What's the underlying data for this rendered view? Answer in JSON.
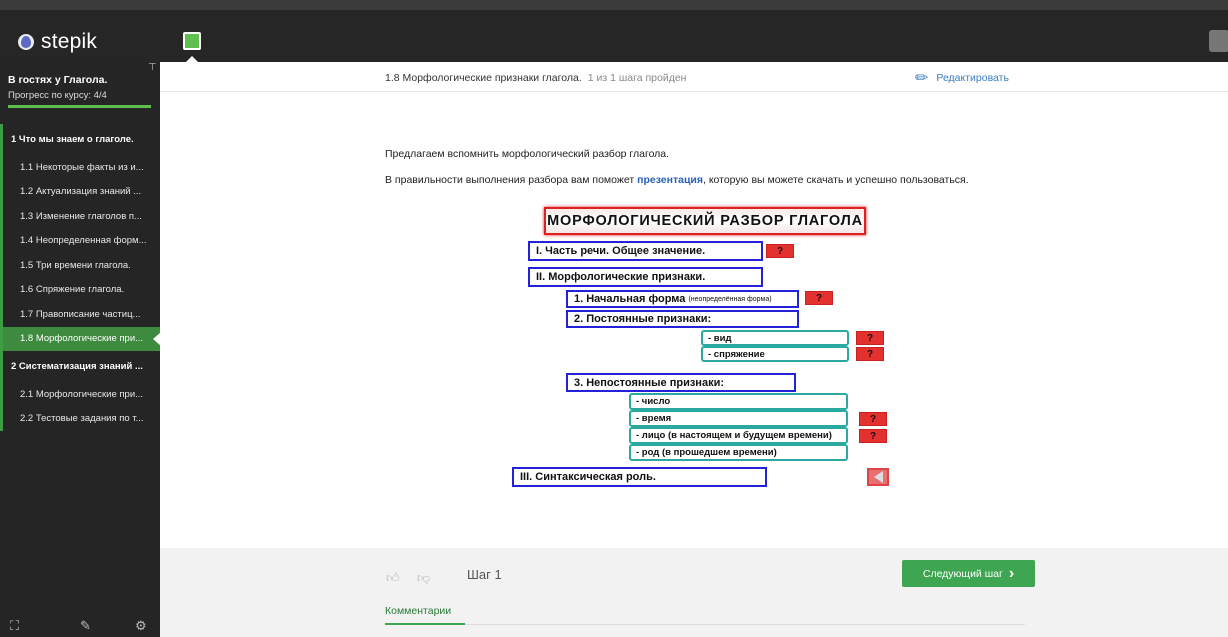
{
  "app": {
    "name": "stepik"
  },
  "sidebar": {
    "course_title": "В гостях у Глагола.",
    "progress_text": "Прогресс по курсу:  4/4",
    "progress": 1.0,
    "sections": [
      {
        "title": "1  Что мы знаем о глаголе.",
        "items": [
          "1.1  Некоторые факты из и...",
          "1.2  Актуализация знаний ...",
          "1.3  Изменение глаголов п...",
          "1.4  Неопределенная форм...",
          "1.5  Три времени глагола.",
          "1.6  Спряжение глагола.",
          "1.7  Правописание частиц...",
          "1.8  Морфологические при..."
        ]
      },
      {
        "title": "2  Систематизация знаний ...",
        "items": [
          "2.1  Морфологические при...",
          "2.2  Тестовые задания по т..."
        ]
      }
    ],
    "active_item": "1.8"
  },
  "header": {
    "step_title": "1.8 Морфологические признаки глагола.",
    "step_progress": "1 из 1 шага пройден",
    "edit_label": "Редактировать"
  },
  "content": {
    "paragraph1": "Предлагаем вспомнить морфологический разбор глагола.",
    "paragraph2_before": "В правильности выполнения разбора вам поможет ",
    "paragraph2_link": "презентация",
    "paragraph2_after": ", которую вы можете скачать и успешно пользоваться."
  },
  "scheme": {
    "title": "МОРФОЛОГИЧЕСКИЙ   РАЗБОР   ГЛАГОЛА",
    "part1": "I.    Часть речи. Общее значение.",
    "part2": "II.   Морфологические  признаки.",
    "initial_form": "1. Начальная форма",
    "initial_form_note": "(неопределённая  форма)",
    "constant": "2. Постоянные признаки:",
    "constant_items": [
      "- вид",
      "- спряжение"
    ],
    "variable": "3. Непостоянные признаки:",
    "variable_items": [
      "- число",
      "- время",
      "- лицо (в настоящем и будущем времени)",
      "- род (в прошедшем времени)"
    ],
    "part3": "III.  Синтаксическая роль.",
    "question_mark": "?"
  },
  "footer": {
    "step_label": "Шаг 1",
    "next_button": "Следующий шаг",
    "next_chevron": "›",
    "comments_tab": "Комментарии"
  },
  "colors": {
    "accent": "#3ea552",
    "topbar": "#262626",
    "sidebar": "#252525",
    "link": "#3b7bbf"
  }
}
